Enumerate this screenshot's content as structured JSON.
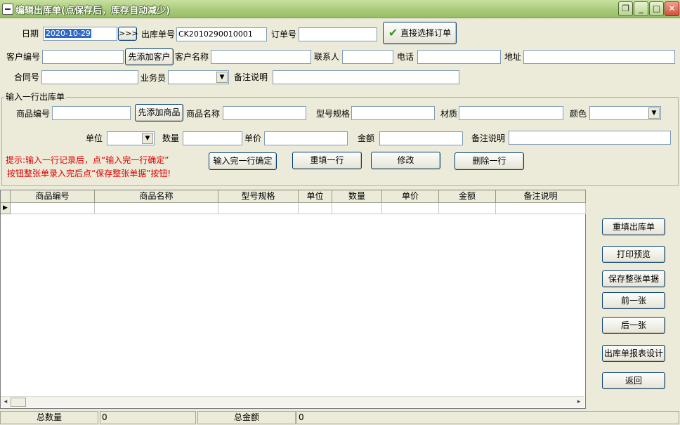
{
  "window": {
    "title": "编辑出库单(点保存后，库存自动减少)",
    "controls": {
      "minimize": "_",
      "restore": "□",
      "maximize": "□",
      "close": "✕"
    }
  },
  "header_form": {
    "date_label": "日期",
    "date_value": "2020-10-29",
    "date_picker": ">>>",
    "outbound_no_label": "出库单号",
    "outbound_no_value": "CK2010290010001",
    "order_no_label": "订单号",
    "order_no_value": "",
    "select_order_button": "直接选择订单",
    "customer_code_label": "客户编号",
    "customer_code_value": "",
    "add_customer_button": "先添加客户",
    "customer_name_label": "客户名称",
    "customer_name_value": "",
    "contact_label": "联系人",
    "contact_value": "",
    "phone_label": "电话",
    "phone_value": "",
    "address_label": "地址",
    "address_value": "",
    "contract_label": "合同号",
    "contract_value": "",
    "salesman_label": "业务员",
    "salesman_value": "",
    "remark_label": "备注说明",
    "remark_value": ""
  },
  "line_entry": {
    "group_title": "输入一行出库单",
    "product_code_label": "商品编号",
    "product_code_value": "",
    "add_product_button": "先添加商品",
    "product_name_label": "商品名称",
    "product_name_value": "",
    "model_label": "型号规格",
    "model_value": "",
    "material_label": "材质",
    "material_value": "",
    "color_label": "颜色",
    "color_value": "",
    "unit_label": "单位",
    "unit_value": "",
    "qty_label": "数量",
    "qty_value": "",
    "price_label": "单价",
    "price_value": "",
    "amount_label": "金额",
    "amount_value": "",
    "line_remark_label": "备注说明",
    "line_remark_value": "",
    "hint_line1": "提示:输入一行记录后，点“输入完一行确定”",
    "hint_line2": "按钮整张单录入完后点“保存整张单据”按钮!",
    "confirm_line_button": "输入完一行确定",
    "refill_line_button": "重填一行",
    "modify_button": "修改",
    "delete_line_button": "删除一行"
  },
  "grid": {
    "columns": [
      "商品编号",
      "商品名称",
      "型号规格",
      "单位",
      "数量",
      "单价",
      "金额",
      "备注说明"
    ],
    "current_row_marker": "▶",
    "scroll_left": "◂",
    "scroll_right": "▸"
  },
  "side_buttons": {
    "reset": "重填出库单",
    "print_preview": "打印预览",
    "save": "保存整张单据",
    "prev": "前一张",
    "next": "后一张",
    "report_design": "出库单报表设计",
    "back": "返回"
  },
  "footer": {
    "total_qty_label": "总数量",
    "total_qty_value": "0",
    "total_amount_label": "总金额",
    "total_amount_value": "0"
  },
  "colors": {
    "hint": "#e00000",
    "titlebar": "#a9cb7a",
    "window_bg": "#ecead8",
    "check_icon": "#2e9a1e"
  }
}
